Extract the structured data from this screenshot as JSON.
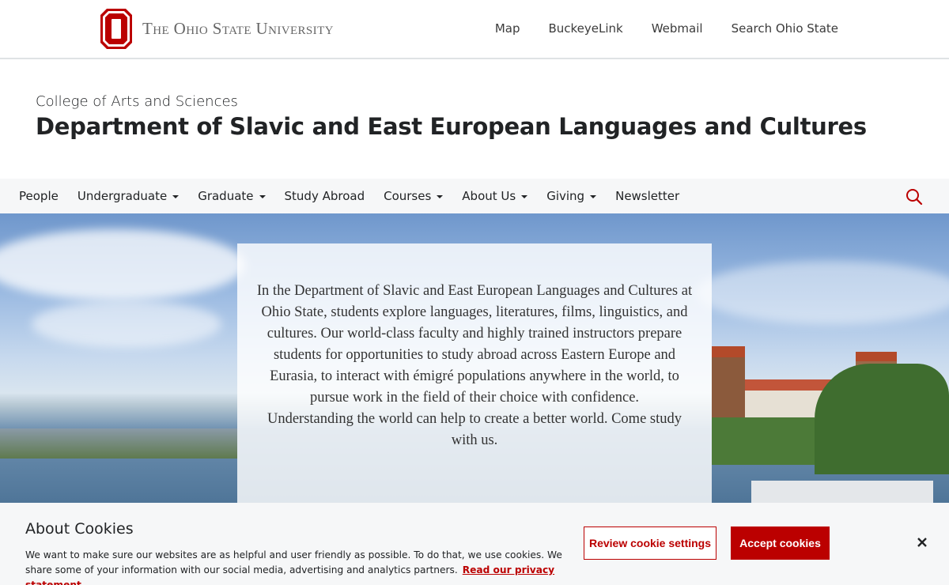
{
  "university": {
    "wordmark": "The Ohio State University",
    "links": [
      "Map",
      "BuckeyeLink",
      "Webmail",
      "Search Ohio State"
    ]
  },
  "header": {
    "college": "College of Arts and Sciences",
    "department": "Department of Slavic and East European Languages and Cultures"
  },
  "nav": {
    "items": [
      {
        "label": "People",
        "dropdown": false
      },
      {
        "label": "Undergraduate",
        "dropdown": true
      },
      {
        "label": "Graduate",
        "dropdown": true
      },
      {
        "label": "Study Abroad",
        "dropdown": false
      },
      {
        "label": "Courses",
        "dropdown": true
      },
      {
        "label": "About Us",
        "dropdown": true
      },
      {
        "label": "Giving",
        "dropdown": true
      },
      {
        "label": "Newsletter",
        "dropdown": false
      }
    ],
    "search_icon": "search-icon"
  },
  "hero": {
    "paragraph1": "In the Department of Slavic and East European Languages and Cultures at Ohio State, students explore languages, literatures, films, linguistics, and cultures. Our world-class faculty and highly trained instructors prepare students for opportunities to study abroad across Eastern Europe and Eurasia, to interact with émigré populations anywhere in the world, to pursue work in the field of their choice with confidence.",
    "paragraph2": "Understanding the world can help to create a better world. Come study with us."
  },
  "cookies": {
    "title": "About Cookies",
    "body": "We want to make sure our websites are as helpful and user friendly as possible. To do that, we use cookies. We share some of your information with our social media, advertising and analytics partners.",
    "privacy_link": "Read our privacy statement",
    "review_label": "Review cookie settings",
    "accept_label": "Accept cookies"
  },
  "colors": {
    "scarlet": "#bb0000",
    "gray": "#666666"
  }
}
